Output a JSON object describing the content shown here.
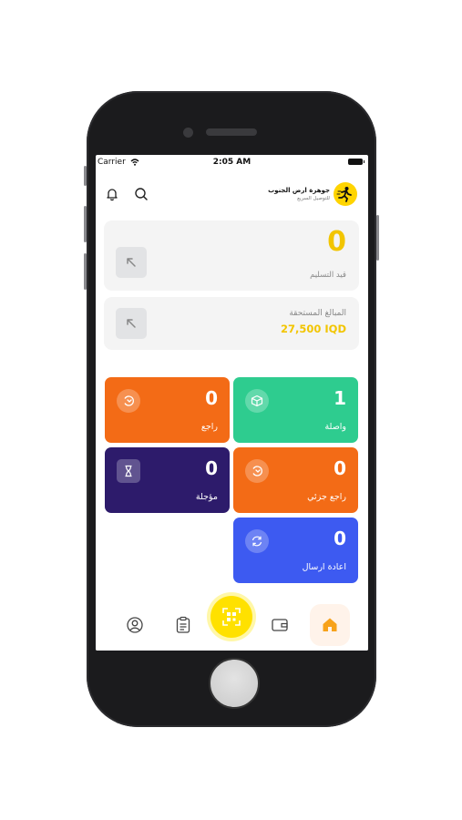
{
  "status_bar": {
    "carrier": "Carrier",
    "time": "2:05 AM"
  },
  "header": {
    "brand_name": "جوهرة ارض الجنوب",
    "brand_subtitle": "للتوصيل السريع",
    "icons": [
      "bell-icon",
      "search-icon"
    ]
  },
  "cards": {
    "pending": {
      "value": "0",
      "label": "قيد التسليم"
    },
    "due": {
      "label": "المبالغ المستحقة",
      "amount": "27,500 IQD"
    }
  },
  "tiles": [
    {
      "id": "arrived",
      "value": "1",
      "label": "واصلة",
      "color": "#2ecc8f",
      "icon": "box-icon"
    },
    {
      "id": "returned",
      "value": "0",
      "label": "راجع",
      "color": "#f36b16",
      "icon": "return-icon"
    },
    {
      "id": "partial-return",
      "value": "0",
      "label": "راجع جزئي",
      "color": "#f36b16",
      "icon": "return-icon"
    },
    {
      "id": "postponed",
      "value": "0",
      "label": "مؤجلة",
      "color": "#2d1b6b",
      "icon": "hourglass-icon"
    },
    {
      "id": "resend",
      "value": "0",
      "label": "اعادة ارسال",
      "color": "#3d5af1",
      "icon": "refresh-icon"
    }
  ],
  "colors": {
    "accent_yellow": "#ffd400",
    "due_amount": "#f2c500",
    "home_icon": "#f7a21b"
  },
  "nav": [
    "profile-icon",
    "clipboard-icon",
    "qr-scan-icon",
    "wallet-icon",
    "home-icon"
  ]
}
